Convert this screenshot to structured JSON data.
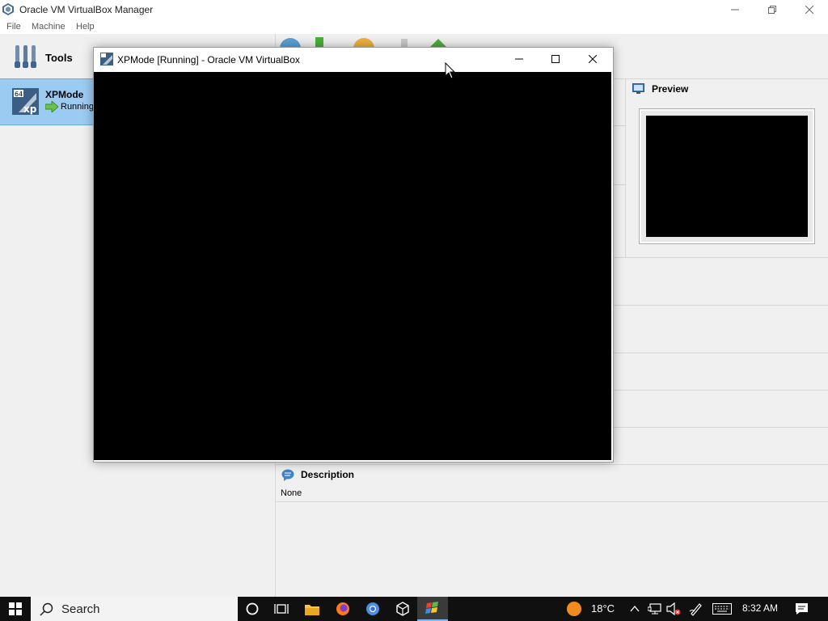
{
  "manager": {
    "title": "Oracle VM VirtualBox Manager",
    "menu": [
      "File",
      "Machine",
      "Help"
    ]
  },
  "sidebar": {
    "tools_label": "Tools",
    "vm": {
      "name": "XPMode",
      "state": "Running"
    }
  },
  "details": {
    "preview_title": "Preview",
    "description_title": "Description",
    "description_value": "None"
  },
  "vm_window": {
    "title": "XPMode [Running] - Oracle VM VirtualBox"
  },
  "taskbar": {
    "search_placeholder": "Search",
    "temperature": "18°C",
    "time": "8:32 AM"
  },
  "colors": {
    "selection": "#9ccbf2",
    "taskbar": "#101010",
    "active_app_highlight": "#3a3a3a"
  }
}
